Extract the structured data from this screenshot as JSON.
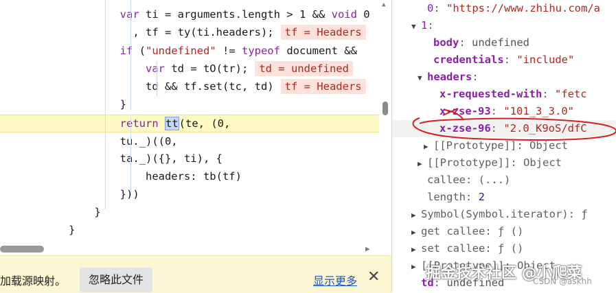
{
  "code": {
    "lines": [
      {
        "parts": [
          [
            "",
            "        "
          ],
          [
            "kw",
            "var"
          ],
          [
            "",
            " ti = arguments.length > 1 && "
          ],
          [
            "kw",
            "void"
          ],
          [
            "",
            " 0"
          ]
        ],
        "inline": ""
      },
      {
        "parts": [
          [
            "",
            "          , tf = ty(ti.headers);"
          ]
        ],
        "inline": "tf = Headers"
      },
      {
        "parts": [
          [
            "",
            "        "
          ],
          [
            "kw",
            "if"
          ],
          [
            "",
            " ("
          ],
          [
            "str",
            "\"undefined\""
          ],
          [
            "",
            " != "
          ],
          [
            "kw",
            "typeof"
          ],
          [
            "",
            " document && "
          ]
        ],
        "inline": ""
      },
      {
        "parts": [
          [
            "",
            "            "
          ],
          [
            "kw",
            "var"
          ],
          [
            "",
            " td = tO(tr);"
          ]
        ],
        "inline": "td = undefined"
      },
      {
        "parts": [
          [
            "",
            "            td && tf.set(tc, td)"
          ]
        ],
        "inline": "tf = Headers"
      },
      {
        "parts": [
          [
            "",
            "        }"
          ]
        ],
        "inline": ""
      },
      {
        "parts": [
          [
            "",
            "        "
          ],
          [
            "kw",
            "return"
          ],
          [
            "",
            " "
          ],
          [
            "sel",
            "tt"
          ],
          [
            "",
            "(te, (0,"
          ]
        ],
        "inline": ""
      },
      {
        "parts": [
          [
            "",
            "        tu._)((0,"
          ]
        ],
        "inline": ""
      },
      {
        "parts": [
          [
            "",
            "        ta._)({}, ti), {"
          ]
        ],
        "inline": ""
      },
      {
        "parts": [
          [
            "",
            "            headers: tb(tf)"
          ]
        ],
        "inline": ""
      },
      {
        "parts": [
          [
            "",
            "        }))"
          ]
        ],
        "inline": ""
      },
      {
        "parts": [
          [
            "",
            "    }"
          ]
        ],
        "inline": ""
      },
      {
        "parts": [
          [
            "",
            "}"
          ]
        ],
        "inline": ""
      }
    ]
  },
  "notice": {
    "text": "加载源映射。",
    "ignore_button": "忽略此文件",
    "show_more": "显示更多",
    "close": "✕"
  },
  "tree": {
    "rows": [
      {
        "indent": 3,
        "tri": "",
        "key": "0",
        "bold": false,
        "sep": ": ",
        "val": "\"https://www.zhihu.com/a",
        "vtype": "s"
      },
      {
        "indent": 2,
        "tri": "▼",
        "key": "1",
        "bold": false,
        "sep": ":",
        "val": "",
        "vtype": "u"
      },
      {
        "indent": 4,
        "tri": "",
        "key": "body",
        "bold": true,
        "sep": ": ",
        "val": "undefined",
        "vtype": "u"
      },
      {
        "indent": 4,
        "tri": "",
        "key": "credentials",
        "bold": true,
        "sep": ": ",
        "val": "\"include\"",
        "vtype": "s"
      },
      {
        "indent": 3,
        "tri": "▼",
        "key": "headers",
        "bold": true,
        "sep": ":",
        "val": "",
        "vtype": "u"
      },
      {
        "indent": 5,
        "tri": "",
        "key": "x-requested-with",
        "bold": true,
        "sep": ": ",
        "val": "\"fetc",
        "vtype": "s"
      },
      {
        "indent": 5,
        "tri": "",
        "key": "x-zse-93",
        "bold": true,
        "sep": ": ",
        "val": "\"101_3_3.0\"",
        "vtype": "s"
      },
      {
        "indent": 5,
        "tri": "",
        "key": "x-zse-96",
        "bold": true,
        "sep": ": ",
        "val": "\"2.0_K9oS/dfC",
        "vtype": "s"
      },
      {
        "indent": 4,
        "tri": "▶",
        "key": "[[Prototype]]",
        "bold": false,
        "sep": ": ",
        "val": "Object",
        "vtype": "g"
      },
      {
        "indent": 3,
        "tri": "▶",
        "key": "[[Prototype]]",
        "bold": false,
        "sep": ": ",
        "val": "Object",
        "vtype": "g"
      },
      {
        "indent": 3,
        "tri": "",
        "key": "callee",
        "bold": false,
        "sep": ": ",
        "val": "(...)",
        "vtype": "g"
      },
      {
        "indent": 3,
        "tri": "",
        "key": "length",
        "bold": false,
        "sep": ": ",
        "val": "2",
        "vtype": "n"
      },
      {
        "indent": 2,
        "tri": "▶",
        "key": "Symbol(Symbol.iterator)",
        "bold": false,
        "sep": ": ",
        "val": "ƒ",
        "vtype": "g"
      },
      {
        "indent": 2,
        "tri": "▶",
        "key": "get callee",
        "bold": false,
        "sep": ": ",
        "val": "ƒ ()",
        "vtype": "g"
      },
      {
        "indent": 2,
        "tri": "▶",
        "key": "set callee",
        "bold": false,
        "sep": ": ",
        "val": "ƒ ()",
        "vtype": "g"
      },
      {
        "indent": 2,
        "tri": "▶",
        "key": "[[Prototype]]",
        "bold": false,
        "sep": ": ",
        "val": "Object",
        "vtype": "g"
      },
      {
        "indent": 2,
        "tri": "",
        "key": "td",
        "bold": true,
        "sep": ": ",
        "val": "undefined",
        "vtype": "u"
      }
    ]
  },
  "watermark": "掘金技术社区 @小爬菜",
  "csdn_mark": "CSDN @askhh"
}
